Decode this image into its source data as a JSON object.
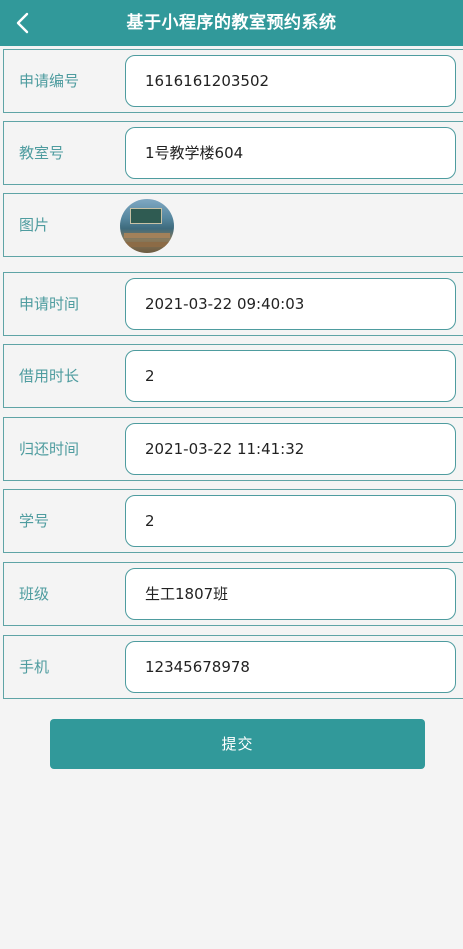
{
  "header": {
    "title": "基于小程序的教室预约系统",
    "back_icon": "chevron-left-icon",
    "color": "#31999a"
  },
  "form": {
    "application_no": {
      "label": "申请编号",
      "value": "1616161203502"
    },
    "classroom_no": {
      "label": "教室号",
      "value": "1号教学楼604"
    },
    "picture": {
      "label": "图片",
      "image": "classroom-photo"
    },
    "apply_time": {
      "label": "申请时间",
      "value": "2021-03-22 09:40:03"
    },
    "borrow_duration": {
      "label": "借用时长",
      "value": "2"
    },
    "return_time": {
      "label": "归还时间",
      "value": "2021-03-22 11:41:32"
    },
    "student_no": {
      "label": "学号",
      "value": "2"
    },
    "class_name": {
      "label": "班级",
      "value": "生工1807班"
    },
    "phone": {
      "label": "手机",
      "value": "12345678978"
    }
  },
  "submit": {
    "label": "提交"
  }
}
